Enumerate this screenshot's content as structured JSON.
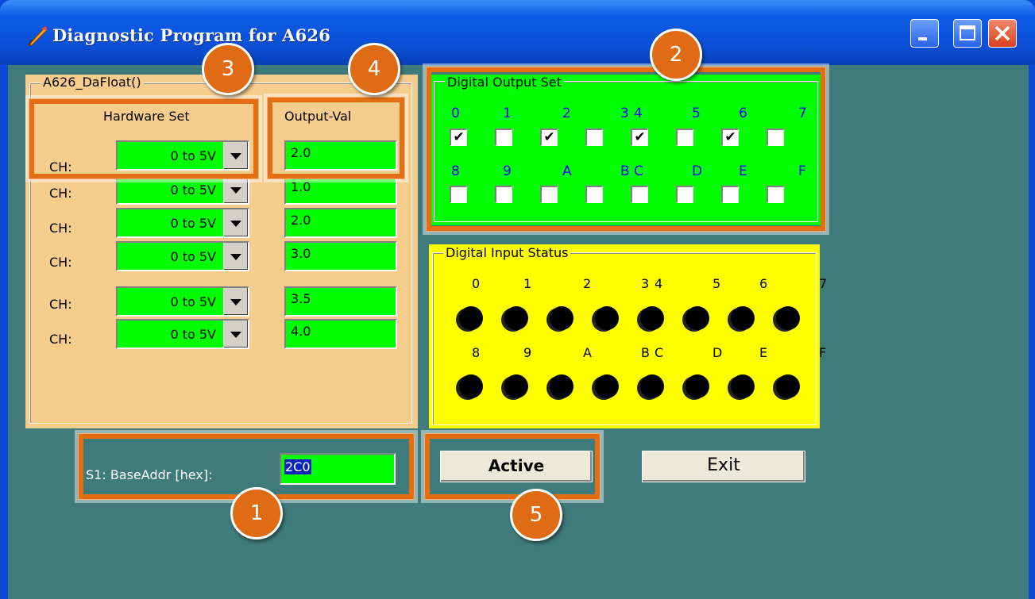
{
  "window": {
    "title": "Diagnostic Program for A626",
    "icon": "app-feather-icon"
  },
  "da_group": {
    "label": "A626_DaFloat()",
    "hardware_header": "Hardware Set",
    "output_header": "Output-Val",
    "channels": [
      {
        "label": "CH:",
        "range": "0 to  5V",
        "value": "2.0"
      },
      {
        "label": "CH:",
        "range": "0 to  5V",
        "value": "1.0"
      },
      {
        "label": "CH:",
        "range": "0 to  5V",
        "value": "2.0"
      },
      {
        "label": "CH:",
        "range": "0 to  5V",
        "value": "3.0"
      },
      {
        "label": "CH:",
        "range": "0 to  5V",
        "value": "3.5"
      },
      {
        "label": "CH:",
        "range": "0 to  5V",
        "value": "4.0"
      }
    ]
  },
  "digital_output": {
    "label": "Digital Output Set",
    "bits_row1": [
      "0",
      "1",
      "2",
      "3",
      "4",
      "5",
      "6",
      "7"
    ],
    "bits_row2": [
      "8",
      "9",
      "A",
      "B",
      "C",
      "D",
      "E",
      "F"
    ],
    "checked_row1": [
      true,
      false,
      true,
      false,
      true,
      false,
      true,
      false
    ],
    "checked_row2": [
      false,
      false,
      false,
      false,
      false,
      false,
      false,
      false
    ],
    "check_mark": "✔"
  },
  "digital_input": {
    "label": "Digital Input Status",
    "bits_row1": [
      "0",
      "1",
      "2",
      "3",
      "4",
      "5",
      "6",
      "7"
    ],
    "bits_row2": [
      "8",
      "9",
      "A",
      "B",
      "C",
      "D",
      "E",
      "F"
    ]
  },
  "base_addr": {
    "label": "S1: BaseAddr [hex]:",
    "value": "2C0"
  },
  "buttons": {
    "active": "Active",
    "exit": "Exit"
  },
  "badges": [
    "1",
    "2",
    "3",
    "4",
    "5"
  ],
  "colors": {
    "green": "#00ff00",
    "yellow": "#ffff00",
    "panel": "#f7cd8e",
    "client": "#3f7b7b",
    "highlight": "#e46e12"
  }
}
